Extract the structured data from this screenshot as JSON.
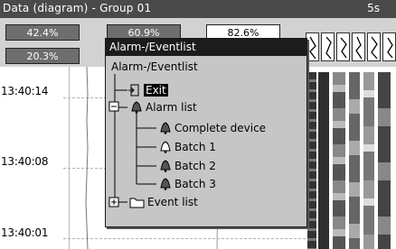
{
  "window": {
    "title": "Data (diagram) - Group 01",
    "interval": "5s"
  },
  "header": {
    "values": [
      {
        "text": "42.4%",
        "style": "dark"
      },
      {
        "text": "60.9%",
        "style": "dark"
      },
      {
        "text": "82.6%",
        "style": "light"
      },
      {
        "text": "20.3%",
        "style": "dark"
      }
    ]
  },
  "chart": {
    "timestamps": [
      "13:40:14",
      "13:40:08",
      "13:40:01"
    ]
  },
  "menu": {
    "header": "Alarm-/Eventlist",
    "root_label": "Alarm-/Eventlist",
    "items": {
      "exit": "Exit",
      "alarm_list": "Alarm list",
      "complete_device": "Complete device",
      "batch1": "Batch 1",
      "batch2": "Batch 2",
      "batch3": "Batch 3",
      "event_list": "Event list"
    },
    "expand_symbols": {
      "alarm_list": "−",
      "event_list": "+"
    }
  },
  "icons": {
    "exit": "exit-door-icon",
    "alarm": "bell-icon",
    "event": "folder-icon",
    "tracker": "trend-tracker-icon"
  },
  "colors": {
    "titlebar": "#4a4a4a",
    "menu_header": "#1c1c1c",
    "menu_body": "#c6c6c6"
  }
}
